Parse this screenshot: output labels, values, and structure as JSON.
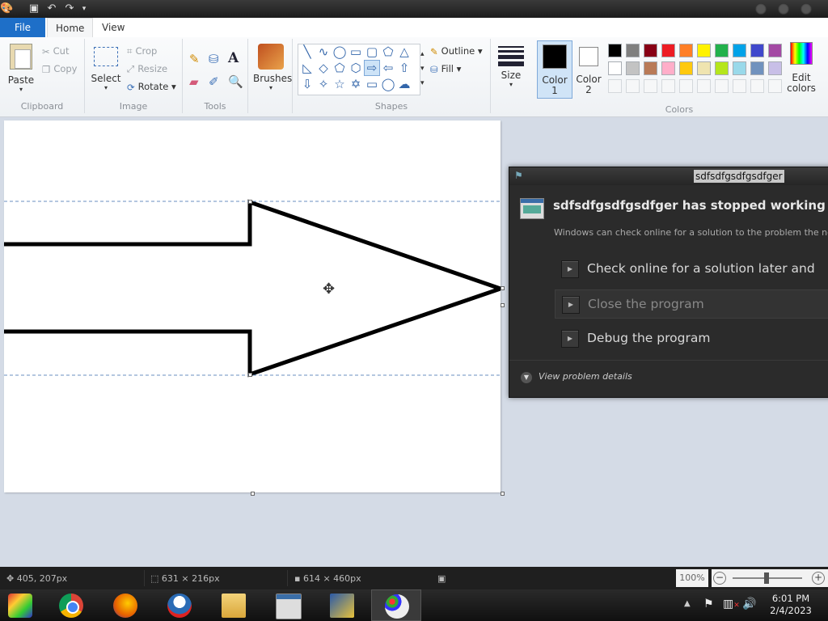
{
  "titlebar": {
    "quick_access": [
      "paint-app-icon",
      "save-icon",
      "undo-icon",
      "redo-icon",
      "customize-icon"
    ]
  },
  "tabs": {
    "file": "File",
    "home": "Home",
    "view": "View"
  },
  "ribbon": {
    "clipboard": {
      "label": "Clipboard",
      "paste": "Paste",
      "cut": "Cut",
      "copy": "Copy"
    },
    "image": {
      "label": "Image",
      "select": "Select",
      "crop": "Crop",
      "resize": "Resize",
      "rotate": "Rotate"
    },
    "tools": {
      "label": "Tools"
    },
    "brushes": {
      "label": "Brushes"
    },
    "shapes": {
      "label": "Shapes",
      "outline": "Outline",
      "fill": "Fill"
    },
    "size": {
      "label": "Size"
    },
    "color1": {
      "label1": "Color",
      "label2": "1",
      "color": "#000000"
    },
    "color2": {
      "label1": "Color",
      "label2": "2",
      "color": "#ffffff"
    },
    "colors": {
      "label": "Colors",
      "edit1": "Edit",
      "edit2": "colors",
      "palette_row1": [
        "#000000",
        "#7f7f7f",
        "#880015",
        "#ed1c24",
        "#ff7f27",
        "#fff200",
        "#22b14c",
        "#00a2e8",
        "#3f48cc",
        "#a349a4"
      ],
      "palette_row2": [
        "#ffffff",
        "#c3c3c3",
        "#b97a57",
        "#ffaec9",
        "#ffc90e",
        "#efe4b0",
        "#b5e61d",
        "#99d9ea",
        "#7092be",
        "#c8bfe7"
      ]
    }
  },
  "dialog": {
    "title": "sdfsdfgsdfgsdfger",
    "heading": "sdfsdfgsdfgsdfger has stopped working",
    "message": "Windows can check online for a solution to the problem the next ti",
    "options": [
      "Check online for a solution later and close",
      "Close the program",
      "Debug the program"
    ],
    "details": "View problem details"
  },
  "statusbar": {
    "cursor": "405, 207px",
    "selection": "631 × 216px",
    "canvas_size": "614 × 460px",
    "zoom": "100%"
  },
  "taskbar": {
    "apps": [
      "Internet Explorer",
      "Chrome",
      "Firefox",
      "Obama",
      "Explorer",
      "Error app",
      "Winamp",
      "Paint"
    ],
    "time": "6:01 PM",
    "date": "2/4/2023"
  }
}
